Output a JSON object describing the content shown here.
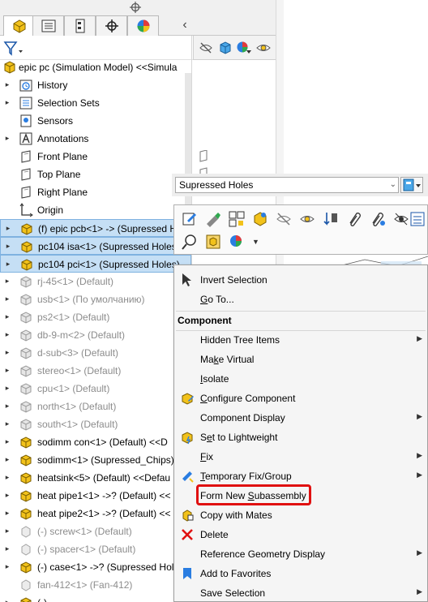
{
  "tabs": [
    {
      "name": "featuremanager-tab"
    },
    {
      "name": "propertymanager-tab"
    },
    {
      "name": "configurationmanager-tab"
    },
    {
      "name": "dimxpert-tab"
    },
    {
      "name": "displaymanager-tab"
    }
  ],
  "tree": {
    "root": "epic pc (Simulation Model) <<Simula",
    "items": [
      {
        "label": "History",
        "icon": "history-icon",
        "expand": true
      },
      {
        "label": "Selection Sets",
        "icon": "selection-sets-icon",
        "expand": true
      },
      {
        "label": "Sensors",
        "icon": "sensors-icon",
        "expand": false
      },
      {
        "label": "Annotations",
        "icon": "annotations-icon",
        "expand": true
      },
      {
        "label": "Front Plane",
        "icon": "plane-icon",
        "expand": false
      },
      {
        "label": "Top Plane",
        "icon": "plane-icon",
        "expand": false
      },
      {
        "label": "Right Plane",
        "icon": "plane-icon",
        "expand": false
      },
      {
        "label": "Origin",
        "icon": "origin-icon",
        "expand": false
      },
      {
        "label": "(f) epic pcb<1> -> (Supressed H",
        "icon": "assembly-icon",
        "expand": true,
        "selected": true
      },
      {
        "label": "pc104 isa<1> (Supressed Holes)",
        "icon": "assembly-icon",
        "expand": true,
        "selected": true
      },
      {
        "label": "pc104 pci<1> (Supressed Holes)",
        "icon": "assembly-icon",
        "expand": true,
        "selected": true
      },
      {
        "label": "rj-45<1> (Default)",
        "icon": "suppressed-assembly-icon",
        "expand": true,
        "dim": true
      },
      {
        "label": "usb<1> (По умолчанию)",
        "icon": "suppressed-assembly-icon",
        "expand": true,
        "dim": true
      },
      {
        "label": "ps2<1> (Default)",
        "icon": "suppressed-assembly-icon",
        "expand": true,
        "dim": true
      },
      {
        "label": "db-9-m<2> (Default)",
        "icon": "suppressed-assembly-icon",
        "expand": true,
        "dim": true
      },
      {
        "label": "d-sub<3> (Default)",
        "icon": "suppressed-assembly-icon",
        "expand": true,
        "dim": true
      },
      {
        "label": "stereo<1> (Default)",
        "icon": "suppressed-assembly-icon",
        "expand": true,
        "dim": true
      },
      {
        "label": "cpu<1> (Default)",
        "icon": "suppressed-assembly-icon",
        "expand": true,
        "dim": true
      },
      {
        "label": "north<1> (Default)",
        "icon": "suppressed-assembly-icon",
        "expand": true,
        "dim": true
      },
      {
        "label": "south<1> (Default)",
        "icon": "suppressed-assembly-icon",
        "expand": true,
        "dim": true
      },
      {
        "label": "sodimm con<1> (Default) <<D",
        "icon": "assembly-icon",
        "expand": true
      },
      {
        "label": "sodimm<1> (Supressed_Chips)",
        "icon": "assembly-icon",
        "expand": true
      },
      {
        "label": "heatsink<5> (Default) <<Defau",
        "icon": "assembly-icon",
        "expand": true
      },
      {
        "label": "heat pipe1<1> ->? (Default) <<",
        "icon": "assembly-icon",
        "expand": true
      },
      {
        "label": "heat pipe2<1> ->? (Default) <<",
        "icon": "assembly-icon",
        "expand": true
      },
      {
        "label": "(-) screw<1> (Default)",
        "icon": "suppressed-part-icon",
        "expand": true,
        "dim": true
      },
      {
        "label": "(-) spacer<1> (Default)",
        "icon": "suppressed-part-icon",
        "expand": true,
        "dim": true
      },
      {
        "label": "(-) case<1> ->? (Supressed Hole",
        "icon": "assembly-icon",
        "expand": true
      },
      {
        "label": "fan-412<1> (Fan-412)",
        "icon": "suppressed-part-icon",
        "expand": false,
        "dim": true
      },
      {
        "label": "(-) ...",
        "icon": "assembly-icon",
        "expand": true
      }
    ]
  },
  "combo": {
    "value": "Supressed Holes"
  },
  "menu": {
    "invert_selection": "Invert Selection",
    "go_to": "Go To...",
    "component_header": "Component",
    "items": [
      {
        "label": "Hidden Tree Items",
        "submenu": true
      },
      {
        "label": "Make Virtual",
        "submenu": false
      },
      {
        "label": "Isolate",
        "submenu": false
      },
      {
        "label": "Configure Component",
        "submenu": false
      },
      {
        "label": "Component Display",
        "submenu": true
      },
      {
        "label": "Set to Lightweight",
        "submenu": false
      },
      {
        "label": "Fix",
        "submenu": true
      },
      {
        "label": "Temporary Fix/Group",
        "submenu": true
      },
      {
        "label": "Form New Subassembly",
        "submenu": false,
        "highlighted": true
      },
      {
        "label": "Copy with Mates",
        "submenu": false
      },
      {
        "label": "Delete",
        "submenu": false
      },
      {
        "label": "Reference Geometry Display",
        "submenu": true
      },
      {
        "label": "Add to Favorites",
        "submenu": false
      },
      {
        "label": "Save Selection",
        "submenu": true
      }
    ]
  },
  "colors": {
    "assembly_yellow": "#f2c21b",
    "selection_blue": "#c5dff5",
    "highlight_red": "#e01010"
  }
}
